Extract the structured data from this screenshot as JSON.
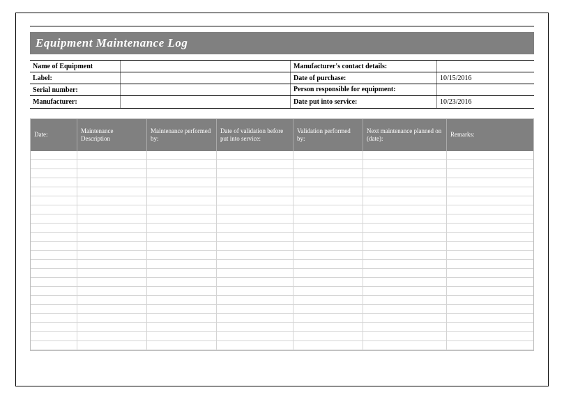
{
  "title": "Equipment Maintenance Log",
  "meta": {
    "row1_left_label": "Name of Equipment",
    "row1_left_value": "",
    "row1_right_label": "Manufacturer's contact details:",
    "row1_right_value": "",
    "row2_left_label": "Label:",
    "row2_left_value": "",
    "row2_right_label": "Date of purchase:",
    "row2_right_value": "10/15/2016",
    "row3_left_label": "Serial number:",
    "row3_left_value": "",
    "row3_right_label": "Person responsible for equipment:",
    "row3_right_value": "",
    "row4_left_label": "Manufacturer:",
    "row4_left_value": "",
    "row4_right_label": "Date put into service:",
    "row4_right_value": "10/23/2016"
  },
  "log_headers": {
    "c1": "Date:",
    "c2": "Maintenance Description",
    "c3": "Maintenance performed by:",
    "c4": "Date of validation before put into service:",
    "c5": "Validation performed by:",
    "c6": "Next maintenance planned on (date):",
    "c7": "Remarks:"
  },
  "log_row_count": 22
}
